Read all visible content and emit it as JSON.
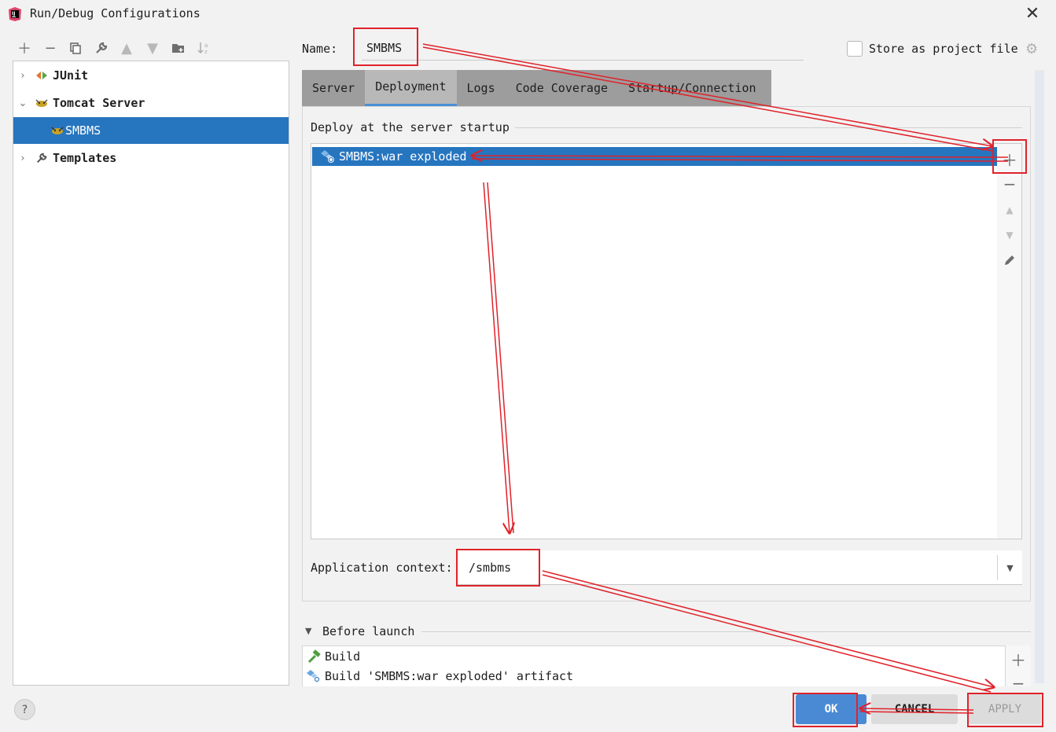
{
  "window": {
    "title": "Run/Debug Configurations",
    "app_icon": "intellij-icon",
    "close_icon": "close-icon"
  },
  "toolbar": {
    "icons": [
      "add-icon",
      "remove-icon",
      "copy-icon",
      "wrench-icon",
      "move-up-icon",
      "move-down-icon",
      "new-folder-icon",
      "sort-icon"
    ]
  },
  "tree": {
    "items": [
      {
        "label": "JUnit",
        "icon": "junit-icon",
        "expanded": false
      },
      {
        "label": "Tomcat Server",
        "icon": "tomcat-icon",
        "expanded": true
      },
      {
        "label": "SMBMS",
        "icon": "tomcat-icon",
        "selected": true
      },
      {
        "label": "Templates",
        "icon": "wrench-icon",
        "expanded": false
      }
    ]
  },
  "name_row": {
    "label": "Name:",
    "value": "SMBMS",
    "store_label": "Store as project file",
    "store_checked": false
  },
  "tabs": [
    {
      "label": "Server",
      "active": false
    },
    {
      "label": "Deployment",
      "active": true
    },
    {
      "label": "Logs",
      "active": false
    },
    {
      "label": "Code Coverage",
      "active": false
    },
    {
      "label": "Startup/Connection",
      "active": false
    }
  ],
  "deployment": {
    "section_label": "Deploy at the server startup",
    "artifacts": [
      "SMBMS:war exploded"
    ],
    "side_tools": [
      "add-icon",
      "remove-icon",
      "move-up-icon",
      "move-down-icon",
      "edit-icon"
    ]
  },
  "app_context": {
    "label": "Application context:",
    "value": "/smbms"
  },
  "before_launch": {
    "label": "Before launch",
    "items": [
      {
        "label": "Build",
        "icon": "hammer-icon"
      },
      {
        "label": "Build 'SMBMS:war exploded' artifact",
        "icon": "artifact-icon"
      }
    ]
  },
  "buttons": {
    "help": "?",
    "ok": "OK",
    "cancel": "CANCEL",
    "apply": "APPLY"
  },
  "colors": {
    "selection": "#2675bf",
    "ok_button": "#4a8ad4",
    "annotation": "#e0222a"
  }
}
